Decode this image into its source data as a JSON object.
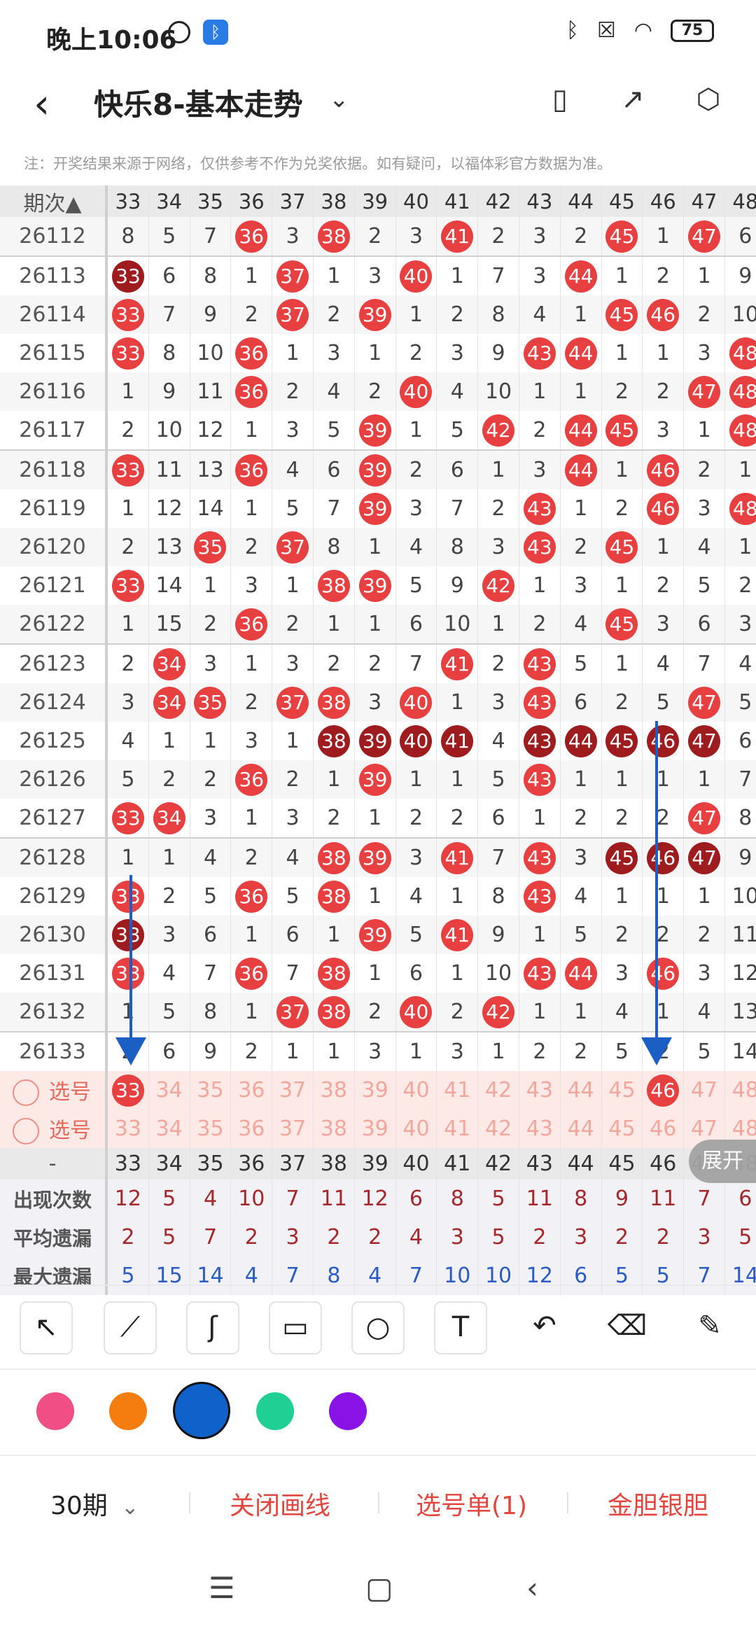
{
  "status": {
    "time": "晚上10:06",
    "battery": "75"
  },
  "header": {
    "title": "快乐8-基本走势"
  },
  "notice": "注：开奖结果来源于网络，仅供参考不作为兑奖依据。如有疑问，以福体彩官方数据为准。",
  "grid": {
    "period_label": "期次",
    "columns": [
      "33",
      "34",
      "35",
      "36",
      "37",
      "38",
      "39",
      "40",
      "41",
      "42",
      "43",
      "44",
      "45",
      "46",
      "47",
      "48"
    ],
    "rows": [
      {
        "p": "26112",
        "v": [
          "8",
          "5",
          "7",
          "36",
          "3",
          "38",
          "2",
          "3",
          "41",
          "2",
          "3",
          "2",
          "45",
          "1",
          "47",
          "6"
        ]
      },
      {
        "p": "26113",
        "v": [
          "33",
          "6",
          "8",
          "1",
          "37",
          "1",
          "3",
          "40",
          "1",
          "7",
          "3",
          "44",
          "1",
          "2",
          "1",
          "9"
        ]
      },
      {
        "p": "26114",
        "v": [
          "33",
          "7",
          "9",
          "2",
          "37",
          "2",
          "39",
          "1",
          "2",
          "8",
          "4",
          "1",
          "45",
          "46",
          "2",
          "10"
        ]
      },
      {
        "p": "26115",
        "v": [
          "33",
          "8",
          "10",
          "36",
          "1",
          "3",
          "1",
          "2",
          "3",
          "9",
          "43",
          "44",
          "1",
          "1",
          "3",
          "48"
        ]
      },
      {
        "p": "26116",
        "v": [
          "1",
          "9",
          "11",
          "36",
          "2",
          "4",
          "2",
          "40",
          "4",
          "10",
          "1",
          "1",
          "2",
          "2",
          "47",
          "48"
        ]
      },
      {
        "p": "26117",
        "v": [
          "2",
          "10",
          "12",
          "1",
          "3",
          "5",
          "39",
          "1",
          "5",
          "42",
          "2",
          "44",
          "45",
          "3",
          "1",
          "48"
        ]
      },
      {
        "p": "26118",
        "v": [
          "33",
          "11",
          "13",
          "36",
          "4",
          "6",
          "39",
          "2",
          "6",
          "1",
          "3",
          "44",
          "1",
          "46",
          "2",
          "1"
        ]
      },
      {
        "p": "26119",
        "v": [
          "1",
          "12",
          "14",
          "1",
          "5",
          "7",
          "39",
          "3",
          "7",
          "2",
          "43",
          "1",
          "2",
          "46",
          "3",
          "48"
        ]
      },
      {
        "p": "26120",
        "v": [
          "2",
          "13",
          "35",
          "2",
          "37",
          "8",
          "1",
          "4",
          "8",
          "3",
          "43",
          "2",
          "45",
          "1",
          "4",
          "1"
        ]
      },
      {
        "p": "26121",
        "v": [
          "33",
          "14",
          "1",
          "3",
          "1",
          "38",
          "39",
          "5",
          "9",
          "42",
          "1",
          "3",
          "1",
          "2",
          "5",
          "2"
        ]
      },
      {
        "p": "26122",
        "v": [
          "1",
          "15",
          "2",
          "36",
          "2",
          "1",
          "1",
          "6",
          "10",
          "1",
          "2",
          "4",
          "45",
          "3",
          "6",
          "3"
        ]
      },
      {
        "p": "26123",
        "v": [
          "2",
          "34",
          "3",
          "1",
          "3",
          "2",
          "2",
          "7",
          "41",
          "2",
          "43",
          "5",
          "1",
          "4",
          "7",
          "4"
        ]
      },
      {
        "p": "26124",
        "v": [
          "3",
          "34",
          "35",
          "2",
          "37",
          "38",
          "3",
          "40",
          "1",
          "3",
          "43",
          "6",
          "2",
          "5",
          "47",
          "5"
        ]
      },
      {
        "p": "26125",
        "v": [
          "4",
          "1",
          "1",
          "3",
          "1",
          "38",
          "39",
          "40",
          "41",
          "4",
          "43",
          "44",
          "45",
          "46",
          "47",
          "6"
        ]
      },
      {
        "p": "26126",
        "v": [
          "5",
          "2",
          "2",
          "36",
          "2",
          "1",
          "39",
          "1",
          "1",
          "5",
          "43",
          "1",
          "1",
          "1",
          "1",
          "7"
        ]
      },
      {
        "p": "26127",
        "v": [
          "33",
          "34",
          "3",
          "1",
          "3",
          "2",
          "1",
          "2",
          "2",
          "6",
          "1",
          "2",
          "2",
          "2",
          "47",
          "8"
        ]
      },
      {
        "p": "26128",
        "v": [
          "1",
          "1",
          "4",
          "2",
          "4",
          "38",
          "39",
          "3",
          "41",
          "7",
          "43",
          "3",
          "45",
          "46",
          "47",
          "9"
        ]
      },
      {
        "p": "26129",
        "v": [
          "33",
          "2",
          "5",
          "36",
          "5",
          "38",
          "1",
          "4",
          "1",
          "8",
          "43",
          "4",
          "1",
          "1",
          "1",
          "10"
        ]
      },
      {
        "p": "26130",
        "v": [
          "33",
          "3",
          "6",
          "1",
          "6",
          "1",
          "39",
          "5",
          "41",
          "9",
          "1",
          "5",
          "2",
          "2",
          "2",
          "11"
        ]
      },
      {
        "p": "26131",
        "v": [
          "33",
          "4",
          "7",
          "36",
          "7",
          "38",
          "1",
          "6",
          "1",
          "10",
          "43",
          "44",
          "3",
          "46",
          "3",
          "12"
        ]
      },
      {
        "p": "26132",
        "v": [
          "1",
          "5",
          "8",
          "1",
          "37",
          "38",
          "2",
          "40",
          "2",
          "42",
          "1",
          "1",
          "4",
          "1",
          "4",
          "13"
        ]
      },
      {
        "p": "26133",
        "v": [
          "2",
          "6",
          "9",
          "2",
          "1",
          "1",
          "3",
          "1",
          "3",
          "1",
          "2",
          "2",
          "5",
          "2",
          "5",
          "14"
        ]
      }
    ],
    "pick_label": "选号",
    "pick_rows": [
      {
        "v": [
          "33",
          "34",
          "35",
          "36",
          "37",
          "38",
          "39",
          "40",
          "41",
          "42",
          "43",
          "44",
          "45",
          "46",
          "47",
          "48"
        ],
        "selected": [
          "33",
          "46"
        ]
      },
      {
        "v": [
          "33",
          "34",
          "35",
          "36",
          "37",
          "38",
          "39",
          "40",
          "41",
          "42",
          "43",
          "44",
          "45",
          "46",
          "47",
          "48"
        ],
        "selected": []
      }
    ],
    "axis_label": "-",
    "stats": [
      {
        "label": "出现次数",
        "v": [
          "12",
          "5",
          "4",
          "10",
          "7",
          "11",
          "12",
          "6",
          "8",
          "5",
          "11",
          "8",
          "9",
          "11",
          "7",
          "6"
        ]
      },
      {
        "label": "平均遗漏",
        "v": [
          "2",
          "5",
          "7",
          "2",
          "3",
          "2",
          "2",
          "4",
          "3",
          "5",
          "2",
          "3",
          "2",
          "2",
          "3",
          "5"
        ]
      },
      {
        "label": "最大遗漏",
        "v": [
          "5",
          "15",
          "14",
          "4",
          "7",
          "8",
          "4",
          "7",
          "10",
          "10",
          "12",
          "6",
          "5",
          "5",
          "7",
          "14"
        ]
      }
    ]
  },
  "expand_label": "展开",
  "colors": {
    "pink": "#ef4f84",
    "orange": "#f57c0e",
    "blue": "#0f62c9",
    "green": "#1fcf93",
    "purple": "#8a12e6",
    "ball_red": "#e84040",
    "ball_dark": "#9e1b1e",
    "arrow": "#1b5ec4"
  },
  "footer": {
    "period": "30期",
    "close_draw": "关闭画线",
    "pick_list": "选号单(1)",
    "golden": "金胆银胆"
  }
}
